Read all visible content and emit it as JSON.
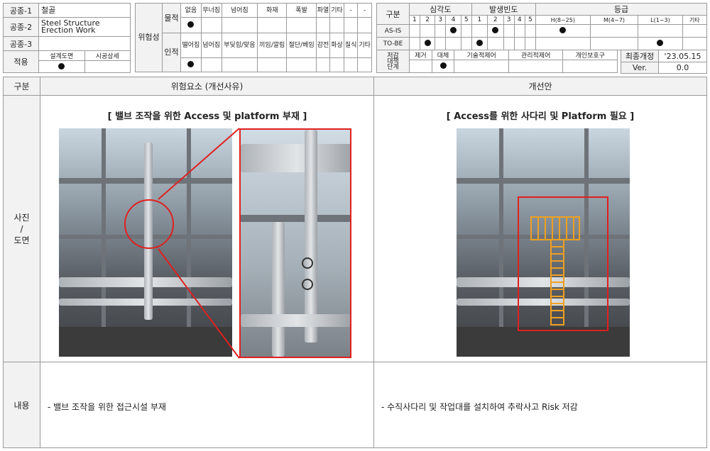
{
  "info": {
    "rows": [
      {
        "label": "공종-1",
        "value": "철골"
      },
      {
        "label": "공종-2",
        "value": "Steel Structure\nErection Work"
      },
      {
        "label": "공종-3",
        "value": ""
      }
    ],
    "apply": {
      "label": "적용",
      "col1": "설계도면",
      "col2": "시공상세"
    }
  },
  "hazard": {
    "title": "위험성",
    "physical": {
      "label": "물적",
      "items": [
        "없음",
        "무너짐",
        "넘어짐",
        "화재",
        "폭발",
        "파열",
        "기타",
        "-",
        "-"
      ]
    },
    "human": {
      "label": "인적",
      "items": [
        "떨어짐",
        "넘어짐",
        "부딪힘/맞음",
        "끼임/깔림",
        "절단/베임",
        "감전",
        "화상",
        "질식",
        "기타"
      ]
    }
  },
  "grade": {
    "label": "구분",
    "severity": "심각도",
    "frequency": "발생빈도",
    "level": "등급",
    "nums": [
      "1",
      "2",
      "3",
      "4",
      "5"
    ],
    "levels": [
      "H(8~25)",
      "M(4~7)",
      "L(1~3)",
      "기타"
    ],
    "rows": [
      "AS-IS",
      "TO-BE"
    ]
  },
  "reduction": {
    "label": "저감\n대책\n단계",
    "items": [
      "제거",
      "대체",
      "기술적제어",
      "관리적제어",
      "개인보호구"
    ]
  },
  "revision": {
    "label1": "최종개정",
    "value1": "'23.05.15",
    "label2": "Ver.",
    "value2": "0.0"
  },
  "main": {
    "col_label": "구분",
    "risk_header": "위험요소 (개선사유)",
    "improve_header": "개선안",
    "photo_label": "사진\n/\n도면",
    "content_label": "내용",
    "risk_caption": "[ 밸브 조작을 위한 Access 및 platform 부재 ]",
    "improve_caption": "[ Access를 위한 사다리 및 Platform 필요 ]",
    "risk_text": "-  밸브 조작을 위한 접근시설 부재",
    "improve_text": "-    수직사다리 및 작업대를 설치하여 추락사고 Risk 저감"
  },
  "colors": {
    "highlight": "#e02020",
    "ladder": "#f0a020"
  }
}
